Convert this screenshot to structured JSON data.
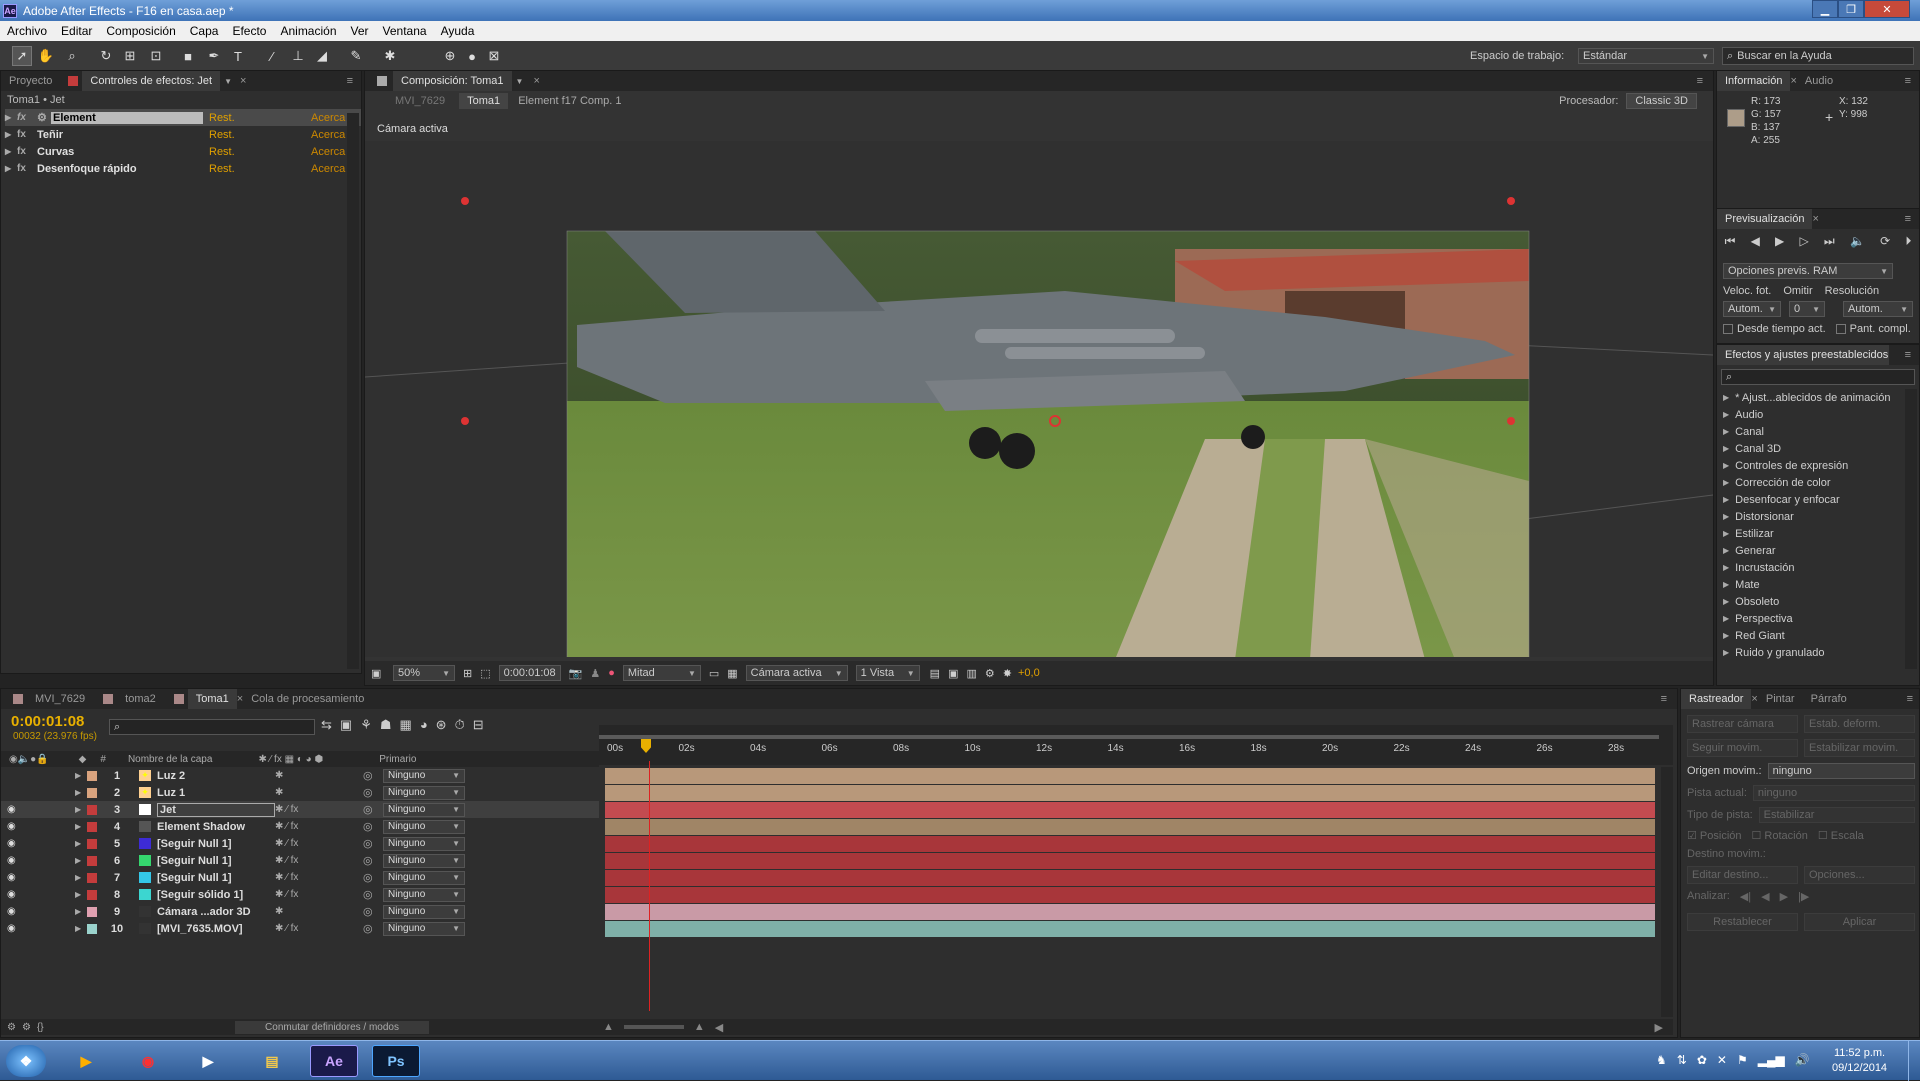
{
  "titlebar": {
    "title": "Adobe After Effects - F16 en casa.aep *",
    "logo": "Ae"
  },
  "menu": [
    "Archivo",
    "Editar",
    "Composición",
    "Capa",
    "Efecto",
    "Animación",
    "Ver",
    "Ventana",
    "Ayuda"
  ],
  "toolbar": {
    "workspace_label": "Espacio de trabajo:",
    "workspace_value": "Estándar",
    "help_placeholder": "Buscar en la Ayuda"
  },
  "effects_panel": {
    "tabs": [
      "Proyecto",
      "Controles de efectos: Jet"
    ],
    "breadcrumb": "Toma1 • Jet",
    "effects": [
      {
        "name": "Element",
        "reset": "Rest.",
        "about": "Acerca d"
      },
      {
        "name": "Teñir",
        "reset": "Rest.",
        "about": "Acerca d"
      },
      {
        "name": "Curvas",
        "reset": "Rest.",
        "about": "Acerca d"
      },
      {
        "name": "Desenfoque rápido",
        "reset": "Rest.",
        "about": "Acerca d"
      }
    ]
  },
  "comp_panel": {
    "tab": "Composición: Toma1",
    "crumbs": [
      "MVI_7629",
      "Toma1",
      "Element f17 Comp. 1"
    ],
    "renderer_label": "Procesador:",
    "renderer_value": "Classic 3D",
    "camera_label": "Cámara activa",
    "footer": {
      "zoom": "50%",
      "timecode": "0:00:01:08",
      "resolution": "Mitad",
      "camera": "Cámara activa",
      "views": "1 Vista",
      "exposure": "+0,0"
    }
  },
  "info_panel": {
    "tabs": [
      "Información",
      "Audio"
    ],
    "r": "R:  173",
    "g": "G:  157",
    "b": "B:  137",
    "a": "A:  255",
    "x": "X:  132",
    "y": "Y:  998",
    "swatch": "#ad9d89"
  },
  "preview_panel": {
    "tab": "Previsualización",
    "ram": "Opciones previs. RAM",
    "frame_rate_label": "Veloc. fot.",
    "skip_label": "Omitir",
    "resolution_label": "Resolución",
    "frame_rate": "Autom.",
    "skip": "0",
    "resolution": "Autom.",
    "from_current": "Desde tiempo act.",
    "full_screen": "Pant. compl."
  },
  "presets_panel": {
    "tab": "Efectos y ajustes preestablecidos",
    "items": [
      "* Ajust...ablecidos de animación",
      "Audio",
      "Canal",
      "Canal 3D",
      "Controles de expresión",
      "Corrección de color",
      "Desenfocar y enfocar",
      "Distorsionar",
      "Estilizar",
      "Generar",
      "Incrustación",
      "Mate",
      "Obsoleto",
      "Perspectiva",
      "Red Giant",
      "Ruido y granulado"
    ]
  },
  "timeline": {
    "tabs": [
      "MVI_7629",
      "toma2",
      "Toma1",
      "Cola de procesamiento"
    ],
    "timecode": "0:00:01:08",
    "frames": "00032 (23.976 fps)",
    "col_hash": "#",
    "col_name": "Nombre de la capa",
    "col_parent": "Primario",
    "ruler": [
      "00s",
      "02s",
      "04s",
      "06s",
      "08s",
      "10s",
      "12s",
      "14s",
      "16s",
      "18s",
      "20s",
      "22s",
      "24s",
      "26s",
      "28s"
    ],
    "toggle_label": "Conmutar definidores / modos",
    "layers": [
      {
        "num": "1",
        "name": "Luz 2",
        "parent": "Ninguno",
        "color": "#d9a37e",
        "bar": "#b8987a",
        "kind": "light"
      },
      {
        "num": "2",
        "name": "Luz 1",
        "parent": "Ninguno",
        "color": "#d9a37e",
        "bar": "#b8987a",
        "kind": "light"
      },
      {
        "num": "3",
        "name": "Jet",
        "parent": "Ninguno",
        "color": "#c43c3c",
        "bar": "#c34b50",
        "kind": "solid"
      },
      {
        "num": "4",
        "name": "Element Shadow",
        "parent": "Ninguno",
        "color": "#c43c3c",
        "bar": "#a08566",
        "kind": "comp"
      },
      {
        "num": "5",
        "name": "[Seguir Null 1]",
        "parent": "Ninguno",
        "color": "#c43c3c",
        "bar": "#a8363a",
        "kind": "solid"
      },
      {
        "num": "6",
        "name": "[Seguir Null 1]",
        "parent": "Ninguno",
        "color": "#c43c3c",
        "bar": "#a8363a",
        "kind": "solid"
      },
      {
        "num": "7",
        "name": "[Seguir Null 1]",
        "parent": "Ninguno",
        "color": "#c43c3c",
        "bar": "#a8363a",
        "kind": "solid"
      },
      {
        "num": "8",
        "name": "[Seguir sólido 1]",
        "parent": "Ninguno",
        "color": "#c43c3c",
        "bar": "#a8363a",
        "kind": "solid"
      },
      {
        "num": "9",
        "name": "Cámara ...ador 3D",
        "parent": "Ninguno",
        "color": "#e0a0b0",
        "bar": "#c99aa6",
        "kind": "camera"
      },
      {
        "num": "10",
        "name": "[MVI_7635.MOV]",
        "parent": "Ninguno",
        "color": "#9ad2cc",
        "bar": "#7fb0a8",
        "kind": "video"
      }
    ],
    "swatches": [
      "#ffd090",
      "#ffd090",
      "#ffffff",
      "#555555",
      "#3d2bd6",
      "#35d66e",
      "#34c7e8",
      "#3cd6d0",
      "#333333",
      "#333333"
    ]
  },
  "tracker_panel": {
    "tabs": [
      "Rastreador",
      "Pintar",
      "Párrafo"
    ],
    "btn_track_camera": "Rastrear cámara",
    "btn_warp": "Estab. deform.",
    "btn_track_motion": "Seguir movim.",
    "btn_stabilize": "Estabilizar movim.",
    "source_label": "Origen movim.:",
    "source_value": "ninguno",
    "current_label": "Pista actual:",
    "current_value": "ninguno",
    "type_label": "Tipo de pista:",
    "type_value": "Estabilizar",
    "pos": "Posición",
    "rot": "Rotación",
    "scale": "Escala",
    "target": "Destino movim.:",
    "edit_target": "Editar destino...",
    "options": "Opciones...",
    "analyze": "Analizar:",
    "reset": "Restablecer",
    "apply": "Aplicar"
  },
  "taskbar": {
    "time": "11:52 p.m.",
    "date": "09/12/2014"
  }
}
